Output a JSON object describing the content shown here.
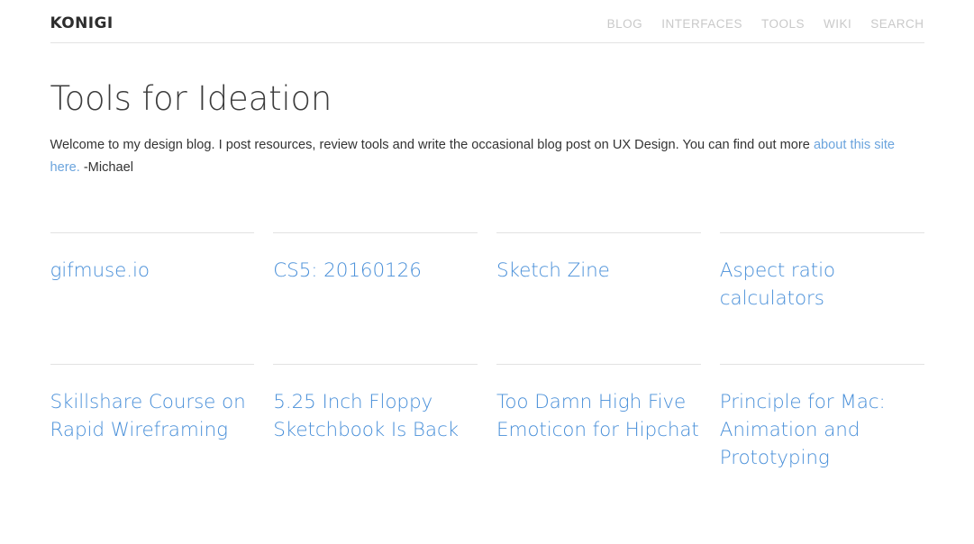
{
  "header": {
    "logo": "KONIGI",
    "nav": [
      {
        "label": "BLOG",
        "name": "nav-link-blog"
      },
      {
        "label": "INTERFACES",
        "name": "nav-link-interfaces"
      },
      {
        "label": "TOOLS",
        "name": "nav-link-tools"
      },
      {
        "label": "WIKI",
        "name": "nav-link-wiki"
      },
      {
        "label": "SEARCH",
        "name": "nav-link-search"
      }
    ]
  },
  "intro": {
    "title": "Tools for Ideation",
    "text_before_link": "Welcome to my design blog. I post resources, review tools and write the occasional blog post on UX Design. You can find out more ",
    "link_text": "about this site here.",
    "text_after_link": " -Michael"
  },
  "posts": [
    {
      "title": "gifmuse.io"
    },
    {
      "title": "CS5: 20160126"
    },
    {
      "title": "Sketch Zine"
    },
    {
      "title": "Aspect ratio calculators"
    },
    {
      "title": "Skillshare Course on Rapid Wireframing"
    },
    {
      "title": "5.25 Inch Floppy Sketchbook Is Back"
    },
    {
      "title": "Too Damn High Five Emoticon for Hipchat"
    },
    {
      "title": "Principle for Mac: Animation and Prototyping"
    }
  ],
  "colors": {
    "link_blue": "#4a90d9",
    "intro_link_blue": "#6ba4dd",
    "nav_gray": "#c9c9c9",
    "heading_dark": "#3c3c3c",
    "rule_gray": "#e2e2e2"
  }
}
